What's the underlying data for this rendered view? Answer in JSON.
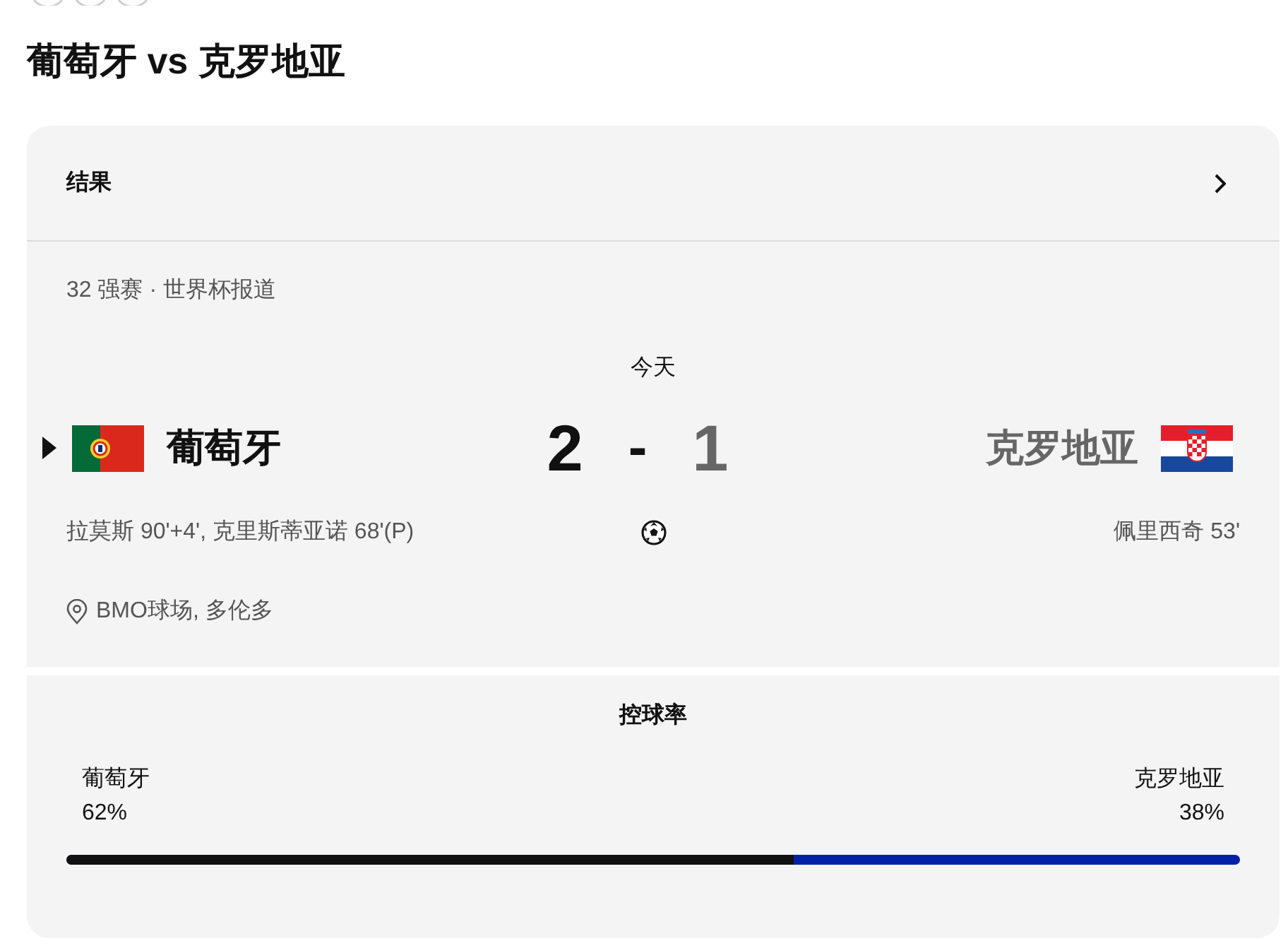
{
  "title": "葡萄牙 vs 克罗地亚",
  "result_card": {
    "header": "结果",
    "competition": "32 强赛 · 世界杯报道",
    "date": "今天",
    "dash": "-",
    "teams": [
      {
        "name": "葡萄牙",
        "score": "2",
        "winner": true,
        "scorers": "拉莫斯 90'+4', 克里斯蒂亚诺 68'(P)"
      },
      {
        "name": "克罗地亚",
        "score": "1",
        "winner": false,
        "scorers": "佩里西奇 53'"
      }
    ],
    "venue": "BMO球场, 多伦多"
  },
  "possession": {
    "title": "控球率",
    "teams": [
      {
        "name": "葡萄牙",
        "percent": "62%"
      },
      {
        "name": "克罗地亚",
        "percent": "38%"
      }
    ],
    "level": 0.62
  }
}
